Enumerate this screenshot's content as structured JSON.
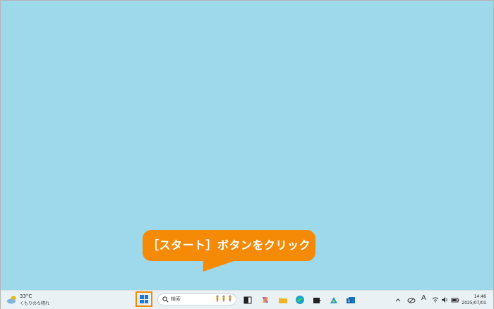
{
  "callout": {
    "text": "［スタート］ボタンをクリック"
  },
  "taskbar": {
    "weather": {
      "temperature": "33°C",
      "condition": "くもりのち晴れ"
    },
    "search": {
      "placeholder": "検索",
      "decoration": "🧍🧍🧍"
    },
    "apps": [
      "task-view-icon",
      "copilot-icon",
      "file-explorer-icon",
      "edge-icon",
      "store-icon",
      "photos-icon",
      "outlook-icon"
    ],
    "tray": {
      "input_indicator": "A"
    },
    "clock": {
      "time": "14:46",
      "date": "2025/07/01"
    },
    "accent": "#f58a07"
  }
}
